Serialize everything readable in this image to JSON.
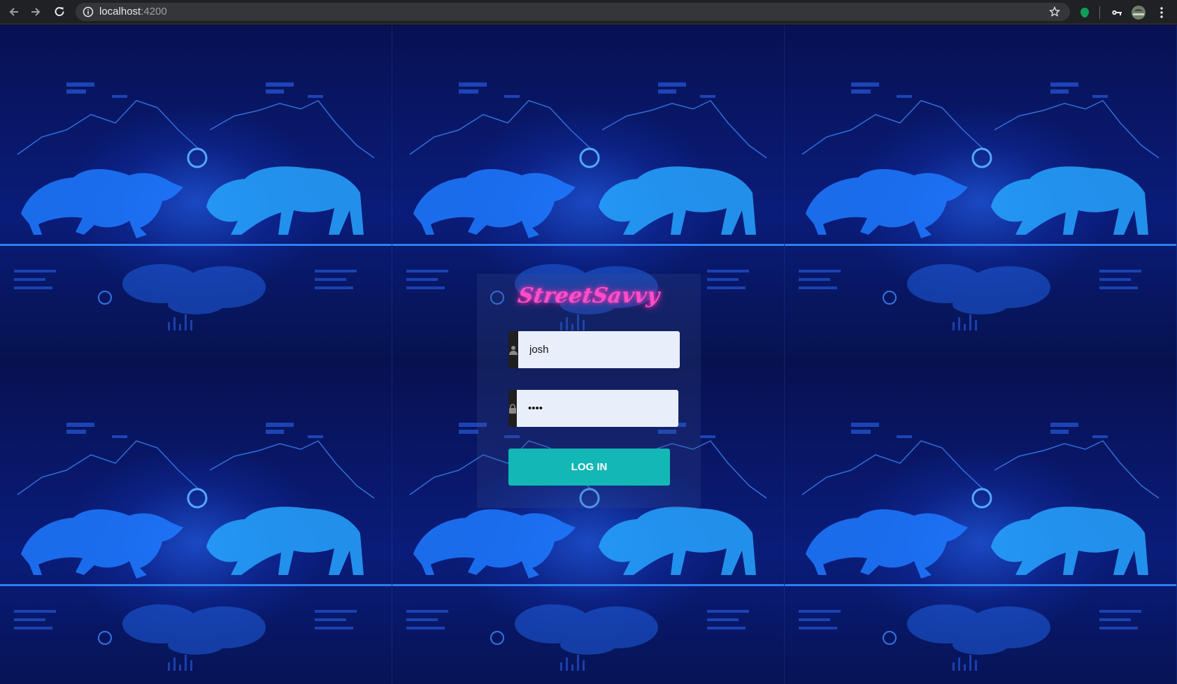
{
  "browser": {
    "url_host": "localhost",
    "url_port": ":4200",
    "icons": {
      "back": "back-arrow-icon",
      "forward": "forward-arrow-icon",
      "reload": "reload-icon",
      "info": "site-info-icon",
      "bookmark": "star-icon",
      "extension": "green-extension-icon",
      "key": "key-icon",
      "profile": "profile-avatar-icon",
      "menu": "kebab-menu-icon"
    }
  },
  "login": {
    "logo_text": "StreetSavvy",
    "username_value": "josh",
    "username_icon": "user-icon",
    "password_value": "josh",
    "password_icon": "lock-icon",
    "submit_label": "LOG IN"
  },
  "colors": {
    "accent": "#13b7b5",
    "logo": "#ff4fc8",
    "input_bg": "#e8effb",
    "background_blue": "#0a1c7a"
  }
}
